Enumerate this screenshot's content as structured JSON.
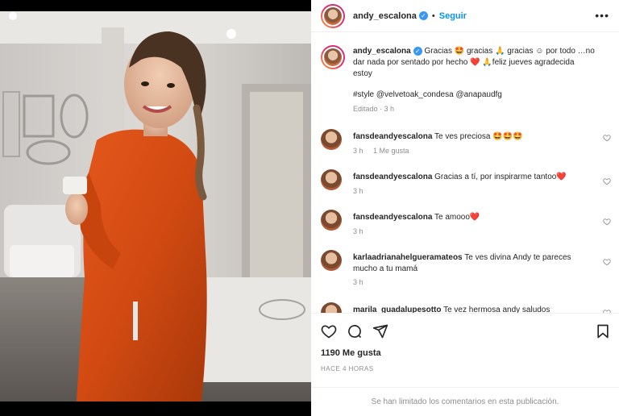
{
  "post": {
    "username": "andy_escalona",
    "follow_label": "Seguir",
    "caption_username": "andy_escalona",
    "caption_text": "Gracias 🤩 gracias 🙏 gracias ☺ por todo …no dar nada por sentado por hecho ❤️ 🙏feliz jueves agradecida estoy",
    "caption_tags": "#style @velvetoak_condesa @anapaudfg",
    "caption_meta": "Editado · 3 h"
  },
  "comments": [
    {
      "username": "fansdeandyescalona",
      "text": "Te ves preciosa 🤩🤩🤩",
      "time": "3 h",
      "likes": "1 Me gusta"
    },
    {
      "username": "fansdeandyescalona",
      "text": "Gracias a tí, por inspirarme tantoo❤️",
      "time": "3 h",
      "likes": ""
    },
    {
      "username": "fansdeandyescalona",
      "text": "Te amooo❤️",
      "time": "3 h",
      "likes": ""
    },
    {
      "username": "karlaadrianahelgueramateos",
      "text": "Te ves divina Andy te pareces mucho a tu mamá",
      "time": "3 h",
      "likes": ""
    },
    {
      "username": "marila_guadalupesotto",
      "text": "Te vez hermosa andy saludos",
      "time": "",
      "likes": ""
    }
  ],
  "footer": {
    "likes": "1190 Me gusta",
    "timestamp": "HACE 4 HORAS",
    "comments_limited": "Se han limitado los comentarios en esta publicación."
  },
  "icons": [
    "more-icon",
    "heart-icon",
    "comment-icon",
    "share-icon",
    "bookmark-icon",
    "verified-icon"
  ]
}
